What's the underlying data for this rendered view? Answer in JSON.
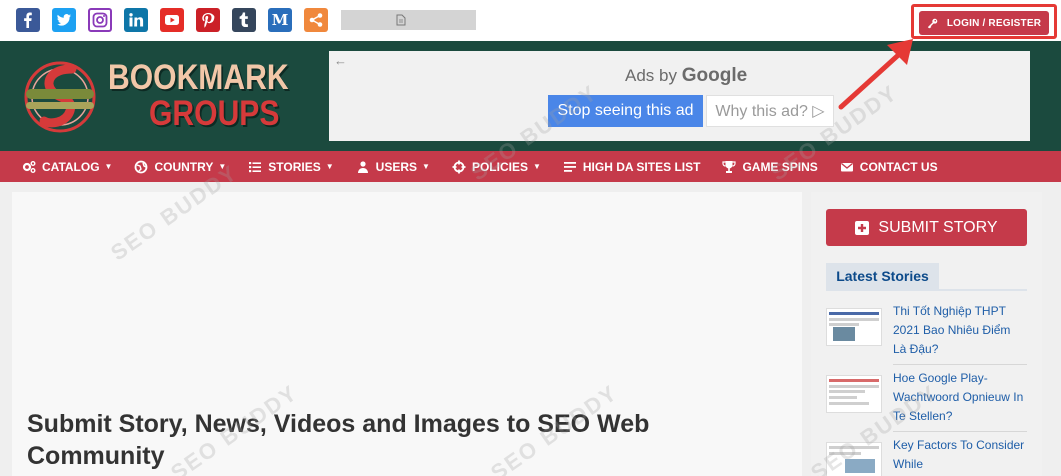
{
  "topbar": {
    "social": [
      {
        "name": "facebook-icon",
        "color": "#3b5998"
      },
      {
        "name": "twitter-icon",
        "color": "#1da1f2"
      },
      {
        "name": "instagram-icon",
        "color": "#8a3ab9"
      },
      {
        "name": "linkedin-icon",
        "color": "#0e76a8"
      },
      {
        "name": "youtube-icon",
        "color": "#e52d27"
      },
      {
        "name": "pinterest-icon",
        "color": "#cb2027"
      },
      {
        "name": "tumblr-icon",
        "color": "#35465c"
      },
      {
        "name": "medium-icon",
        "color": "#2a6ebb"
      },
      {
        "name": "share-icon",
        "color": "#f0883c"
      }
    ],
    "login_label": "LOGIN / REGISTER"
  },
  "logo": {
    "line1": "BOOKMARK",
    "line2": "GROUPS"
  },
  "ad": {
    "ads_by": "Ads by",
    "google": "Google",
    "stop_label": "Stop seeing this ad",
    "why_label": "Why this ad? ▷"
  },
  "nav": {
    "items": [
      {
        "label": "CATALOG",
        "icon": "cogs-icon",
        "caret": true
      },
      {
        "label": "COUNTRY",
        "icon": "globe-icon",
        "caret": true
      },
      {
        "label": "STORIES",
        "icon": "list-icon",
        "caret": true
      },
      {
        "label": "USERS",
        "icon": "user-icon",
        "caret": true
      },
      {
        "label": "POLICIES",
        "icon": "crosshair-icon",
        "caret": true
      },
      {
        "label": "HIGH DA SITES LIST",
        "icon": "doc-list-icon",
        "caret": false
      },
      {
        "label": "GAME SPINS",
        "icon": "trophy-icon",
        "caret": false
      },
      {
        "label": "CONTACT US",
        "icon": "envelope-icon",
        "caret": false
      }
    ]
  },
  "main": {
    "title": "Submit Story, News, Videos and Images to SEO Web Community"
  },
  "sidebar": {
    "submit_label": "SUBMIT STORY",
    "latest_label": "Latest Stories",
    "stories": [
      {
        "title": "Thi Tốt Nghiệp THPT 2021 Bao Nhiêu Điểm Là Đậu?"
      },
      {
        "title": "Hoe Google Play-Wachtwoord Opnieuw In Te Stellen?"
      },
      {
        "title": "Key Factors To Consider While"
      }
    ]
  },
  "colors": {
    "brand_red": "#c53a4a",
    "header_green": "#1b4a3e",
    "link_blue": "#1f5ea8",
    "annotation_red": "#e53935"
  }
}
